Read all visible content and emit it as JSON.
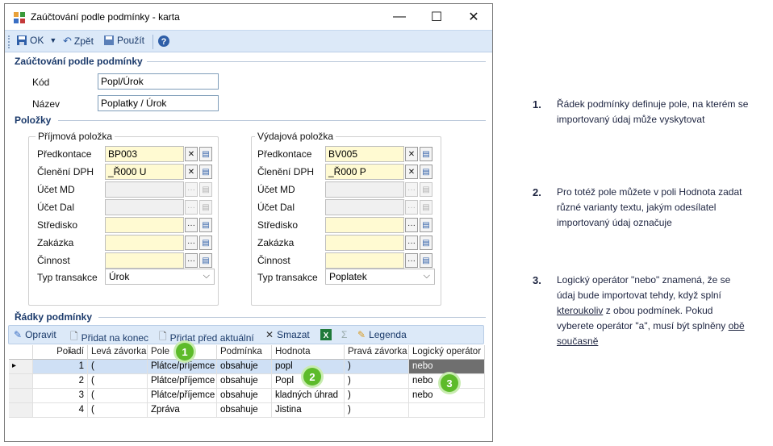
{
  "window": {
    "title": "Zaúčtování podle podmínky - karta",
    "minimize": "—",
    "maximize": "☐",
    "close": "✕"
  },
  "toolbar": {
    "ok": "OK",
    "back": "Zpět",
    "apply": "Použít"
  },
  "section_main": {
    "title": "Zaúčtování podle podmínky",
    "kod_label": "Kód",
    "kod_value": "Popl/Úrok",
    "nazev_label": "Název",
    "nazev_value": "Poplatky / Úrok"
  },
  "section_items": {
    "title": "Položky",
    "income": {
      "title": "Příjmová položka",
      "rows": [
        {
          "label": "Předkontace",
          "value": "BP003"
        },
        {
          "label": "Členění DPH",
          "value": "_Ř000 U"
        },
        {
          "label": "Účet MD",
          "value": ""
        },
        {
          "label": "Účet Dal",
          "value": ""
        },
        {
          "label": "Středisko",
          "value": ""
        },
        {
          "label": "Zakázka",
          "value": ""
        },
        {
          "label": "Činnost",
          "value": ""
        }
      ],
      "typ_label": "Typ transakce",
      "typ_value": "Úrok"
    },
    "expense": {
      "title": "Výdajová položka",
      "rows": [
        {
          "label": "Předkontace",
          "value": "BV005"
        },
        {
          "label": "Členění DPH",
          "value": "_Ř000 P"
        },
        {
          "label": "Účet MD",
          "value": ""
        },
        {
          "label": "Účet Dal",
          "value": ""
        },
        {
          "label": "Středisko",
          "value": ""
        },
        {
          "label": "Zakázka",
          "value": ""
        },
        {
          "label": "Činnost",
          "value": ""
        }
      ],
      "typ_label": "Typ transakce",
      "typ_value": "Poplatek"
    }
  },
  "section_rows": {
    "title": "Řádky podmínky",
    "toolbar": {
      "edit": "Opravit",
      "add_end": "Přidat na konec",
      "add_before": "Přidat před aktuální",
      "delete": "Smazat",
      "sigma": "Σ",
      "legend": "Legenda"
    },
    "columns": [
      "Pořadí",
      "Levá závorka",
      "Pole",
      "Podmínka",
      "Hodnota",
      "Pravá závorka",
      "Logický operátor"
    ],
    "rows": [
      [
        "1",
        "(",
        "Plátce/příjemce",
        "obsahuje",
        "popl",
        ")",
        "nebo"
      ],
      [
        "2",
        "(",
        "Plátce/příjemce",
        "obsahuje",
        "Popl",
        ")",
        "nebo"
      ],
      [
        "3",
        "(",
        "Plátce/příjemce",
        "obsahuje",
        "kladných úhrad",
        ")",
        "nebo"
      ],
      [
        "4",
        "(",
        "Zpráva",
        "obsahuje",
        "Jistina",
        ")",
        ""
      ]
    ]
  },
  "badges": [
    "1",
    "2",
    "3"
  ],
  "notes": [
    {
      "num": "1.",
      "text": "Řádek podmínky definuje pole, na kterém se importovaný údaj může vyskytovat"
    },
    {
      "num": "2.",
      "text": "Pro totéž pole můžete v poli Hodnota zadat různé varianty textu, jakým odesílatel importovaný údaj označuje"
    },
    {
      "num": "3.",
      "text_a": "Logický operátor \"nebo\" znamená, že se údaj bude importovat tehdy, když splní ",
      "text_u1": "kteroukoliv",
      "text_b": " z obou podmínek. Pokud vyberete operátor \"a\", musí být splněny ",
      "text_u2": "obě současně"
    }
  ]
}
